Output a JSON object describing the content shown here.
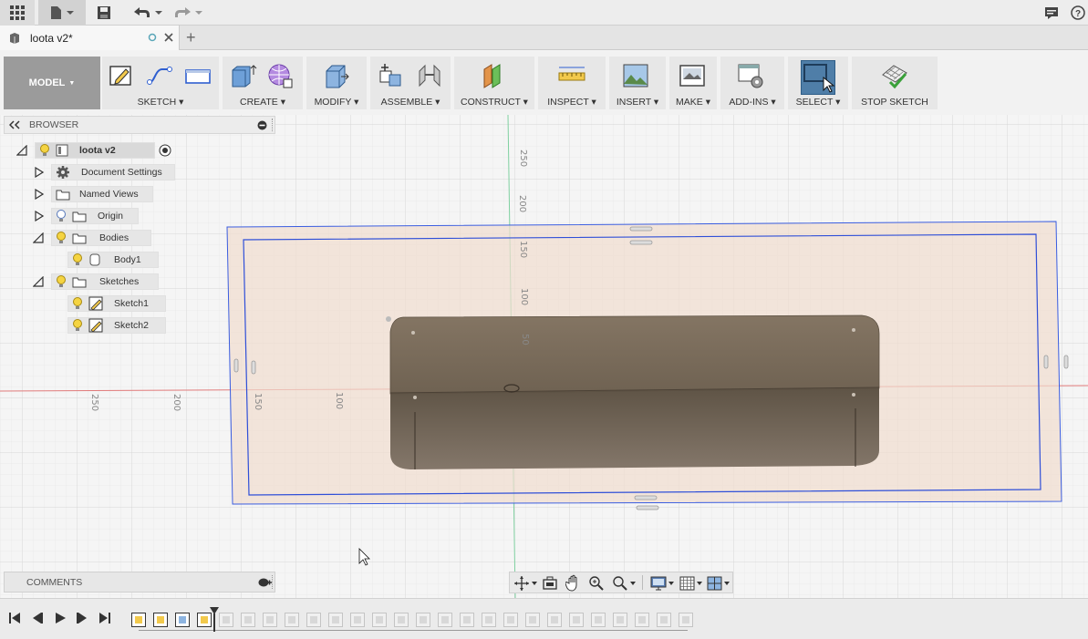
{
  "colors": {
    "accent": "#3a6ea5",
    "select_bg": "#4f7ea8",
    "plane": "#f1ddcf",
    "body": "#7a6c5c",
    "sketch_line": "#2f4fd8"
  },
  "document": {
    "tab_title": "loota v2*",
    "new_tab": "+"
  },
  "toolbar": {
    "workspace": "MODEL",
    "groups": [
      {
        "label": "SKETCH",
        "icon": "sketch-icon"
      },
      {
        "label": "CREATE",
        "icon": "create-icon"
      },
      {
        "label": "MODIFY",
        "icon": "modify-icon"
      },
      {
        "label": "ASSEMBLE",
        "icon": "assemble-icon"
      },
      {
        "label": "CONSTRUCT",
        "icon": "construct-icon"
      },
      {
        "label": "INSPECT",
        "icon": "inspect-icon"
      },
      {
        "label": "INSERT",
        "icon": "insert-icon"
      },
      {
        "label": "MAKE",
        "icon": "make-icon"
      },
      {
        "label": "ADD-INS",
        "icon": "add-ins-icon"
      },
      {
        "label": "SELECT",
        "icon": "select-icon"
      },
      {
        "label": "STOP SKETCH",
        "icon": "stop-sketch-icon"
      }
    ]
  },
  "browser": {
    "title": "BROWSER",
    "root": "loota v2",
    "items": [
      {
        "label": "Document Settings"
      },
      {
        "label": "Named Views"
      },
      {
        "label": "Origin"
      },
      {
        "label": "Bodies"
      },
      {
        "label": "Body1"
      },
      {
        "label": "Sketches"
      },
      {
        "label": "Sketch1"
      },
      {
        "label": "Sketch2"
      }
    ]
  },
  "comments": {
    "title": "COMMENTS"
  },
  "rulers": {
    "vertical": [
      "250",
      "200",
      "150",
      "100",
      "50"
    ],
    "horizontal": [
      "250",
      "200",
      "150",
      "100"
    ]
  }
}
